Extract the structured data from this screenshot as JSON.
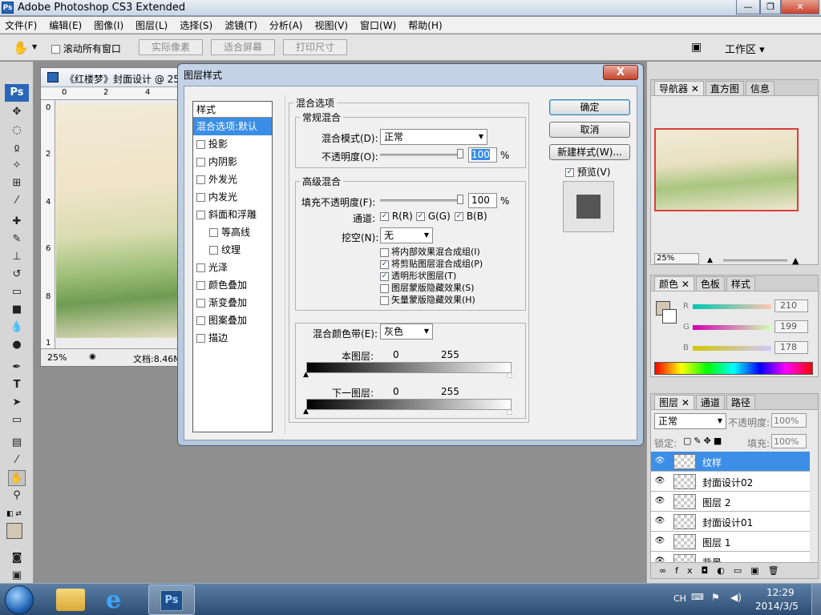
{
  "window": {
    "title": "Adobe Photoshop CS3 Extended",
    "logo": "Ps"
  },
  "menu": [
    "文件(F)",
    "编辑(E)",
    "图像(I)",
    "图层(L)",
    "选择(S)",
    "滤镜(T)",
    "分析(A)",
    "视图(V)",
    "窗口(W)",
    "帮助(H)"
  ],
  "options": {
    "scroll_all": "滚动所有窗口",
    "actual_pixels": "实际像素",
    "fit_screen": "适合屏幕",
    "print_size": "打印尺寸",
    "workspace": "工作区"
  },
  "document": {
    "title": "《红楼梦》封面设计 @ 25",
    "zoom": "25%",
    "info": "文档:8.46M",
    "ruler_h": [
      "0",
      "2",
      "4"
    ],
    "ruler_v": [
      "0",
      "2",
      "4",
      "6",
      "8",
      "1"
    ]
  },
  "dialog": {
    "title": "图层样式",
    "close": "X",
    "styles_header": "样式",
    "styles": [
      {
        "label": "混合选项:默认",
        "selected": true,
        "checkbox": false,
        "sub": false
      },
      {
        "label": "投影",
        "checkbox": true,
        "sub": false
      },
      {
        "label": "内阴影",
        "checkbox": true,
        "sub": false
      },
      {
        "label": "外发光",
        "checkbox": true,
        "sub": false
      },
      {
        "label": "内发光",
        "checkbox": true,
        "sub": false
      },
      {
        "label": "斜面和浮雕",
        "checkbox": true,
        "sub": false
      },
      {
        "label": "等高线",
        "checkbox": true,
        "sub": true
      },
      {
        "label": "纹理",
        "checkbox": true,
        "sub": true
      },
      {
        "label": "光泽",
        "checkbox": true,
        "sub": false
      },
      {
        "label": "颜色叠加",
        "checkbox": true,
        "sub": false
      },
      {
        "label": "渐变叠加",
        "checkbox": true,
        "sub": false
      },
      {
        "label": "图案叠加",
        "checkbox": true,
        "sub": false
      },
      {
        "label": "描边",
        "checkbox": true,
        "sub": false
      }
    ],
    "blend_options": "混合选项",
    "general_blend": "常规混合",
    "blend_mode_label": "混合模式(D):",
    "blend_mode_value": "正常",
    "opacity_label": "不透明度(O):",
    "opacity_value": "100",
    "percent": "%",
    "opacity_level": 1.0,
    "advanced_blend": "高级混合",
    "fill_opacity_label": "填充不透明度(F):",
    "fill_opacity_value": "100",
    "fill_opacity_level": 1.0,
    "channels_label": "通道:",
    "channel_r": "R(R)",
    "channel_g": "G(G)",
    "channel_b": "B(B)",
    "knockout_label": "挖空(N):",
    "knockout_value": "无",
    "adv_options": [
      {
        "label": "将内部效果混合成组(I)",
        "checked": false
      },
      {
        "label": "将剪贴图层混合成组(P)",
        "checked": true
      },
      {
        "label": "透明形状图层(T)",
        "checked": true
      },
      {
        "label": "图层蒙版隐藏效果(S)",
        "checked": false
      },
      {
        "label": "矢量蒙版隐藏效果(H)",
        "checked": false
      }
    ],
    "blend_if_label": "混合颜色带(E):",
    "blend_if_value": "灰色",
    "this_layer_label": "本图层:",
    "this_layer_min": "0",
    "this_layer_max": "255",
    "underlying_label": "下一图层:",
    "underlying_min": "0",
    "underlying_max": "255",
    "ok": "确定",
    "cancel": "取消",
    "new_style": "新建样式(W)...",
    "preview": "预览(V)"
  },
  "navigator": {
    "tabs": [
      "导航器",
      "直方图",
      "信息"
    ],
    "zoom": "25%"
  },
  "color": {
    "tabs": [
      "颜色",
      "色板",
      "样式"
    ],
    "r_label": "R",
    "g_label": "G",
    "b_label": "B",
    "r": "210",
    "g": "199",
    "b": "178",
    "r_level": 0.82,
    "g_level": 0.78,
    "b_level": 0.7,
    "swatch": "#d2c7b2"
  },
  "layers": {
    "tabs": [
      "图层",
      "通道",
      "路径"
    ],
    "mode": "正常",
    "opacity_label": "不透明度:",
    "opacity": "100%",
    "lock_label": "锁定:",
    "fill_label": "填充:",
    "fill": "100%",
    "items": [
      {
        "name": "纹样",
        "selected": true
      },
      {
        "name": "封面设计02",
        "selected": false
      },
      {
        "name": "图层 2",
        "selected": false
      },
      {
        "name": "封面设计01",
        "selected": false
      },
      {
        "name": "图层 1",
        "selected": false
      },
      {
        "name": "背景",
        "selected": false
      }
    ]
  },
  "taskbar": {
    "lang": "CH",
    "time": "12:29",
    "date": "2014/3/5",
    "app": "Ps"
  }
}
